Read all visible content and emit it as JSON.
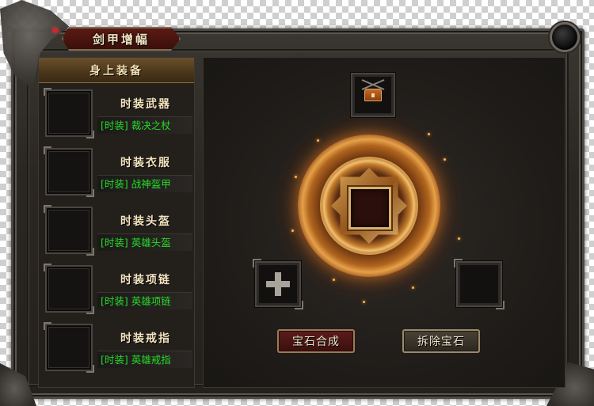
{
  "window": {
    "title": "剑甲增幅"
  },
  "equipment_panel": {
    "header": "身上装备",
    "items": [
      {
        "name": "时装武器",
        "detail": "[时装] 裁决之杖"
      },
      {
        "name": "时装衣服",
        "detail": "[时装] 战神盔甲"
      },
      {
        "name": "时装头盔",
        "detail": "[时装] 英雄头盔"
      },
      {
        "name": "时装项链",
        "detail": "[时装] 英雄项链"
      },
      {
        "name": "时装戒指",
        "detail": "[时装] 英雄戒指"
      }
    ]
  },
  "gem_panel": {
    "top_slot_icon": "treasure-chest-icon",
    "add_slot_icon": "plus-icon",
    "compose_button": "宝石合成",
    "remove_button": "拆除宝石"
  },
  "colors": {
    "title_red": "#5b1a14",
    "detail_green": "#26d926",
    "glow_orange": "#e6a14a"
  }
}
